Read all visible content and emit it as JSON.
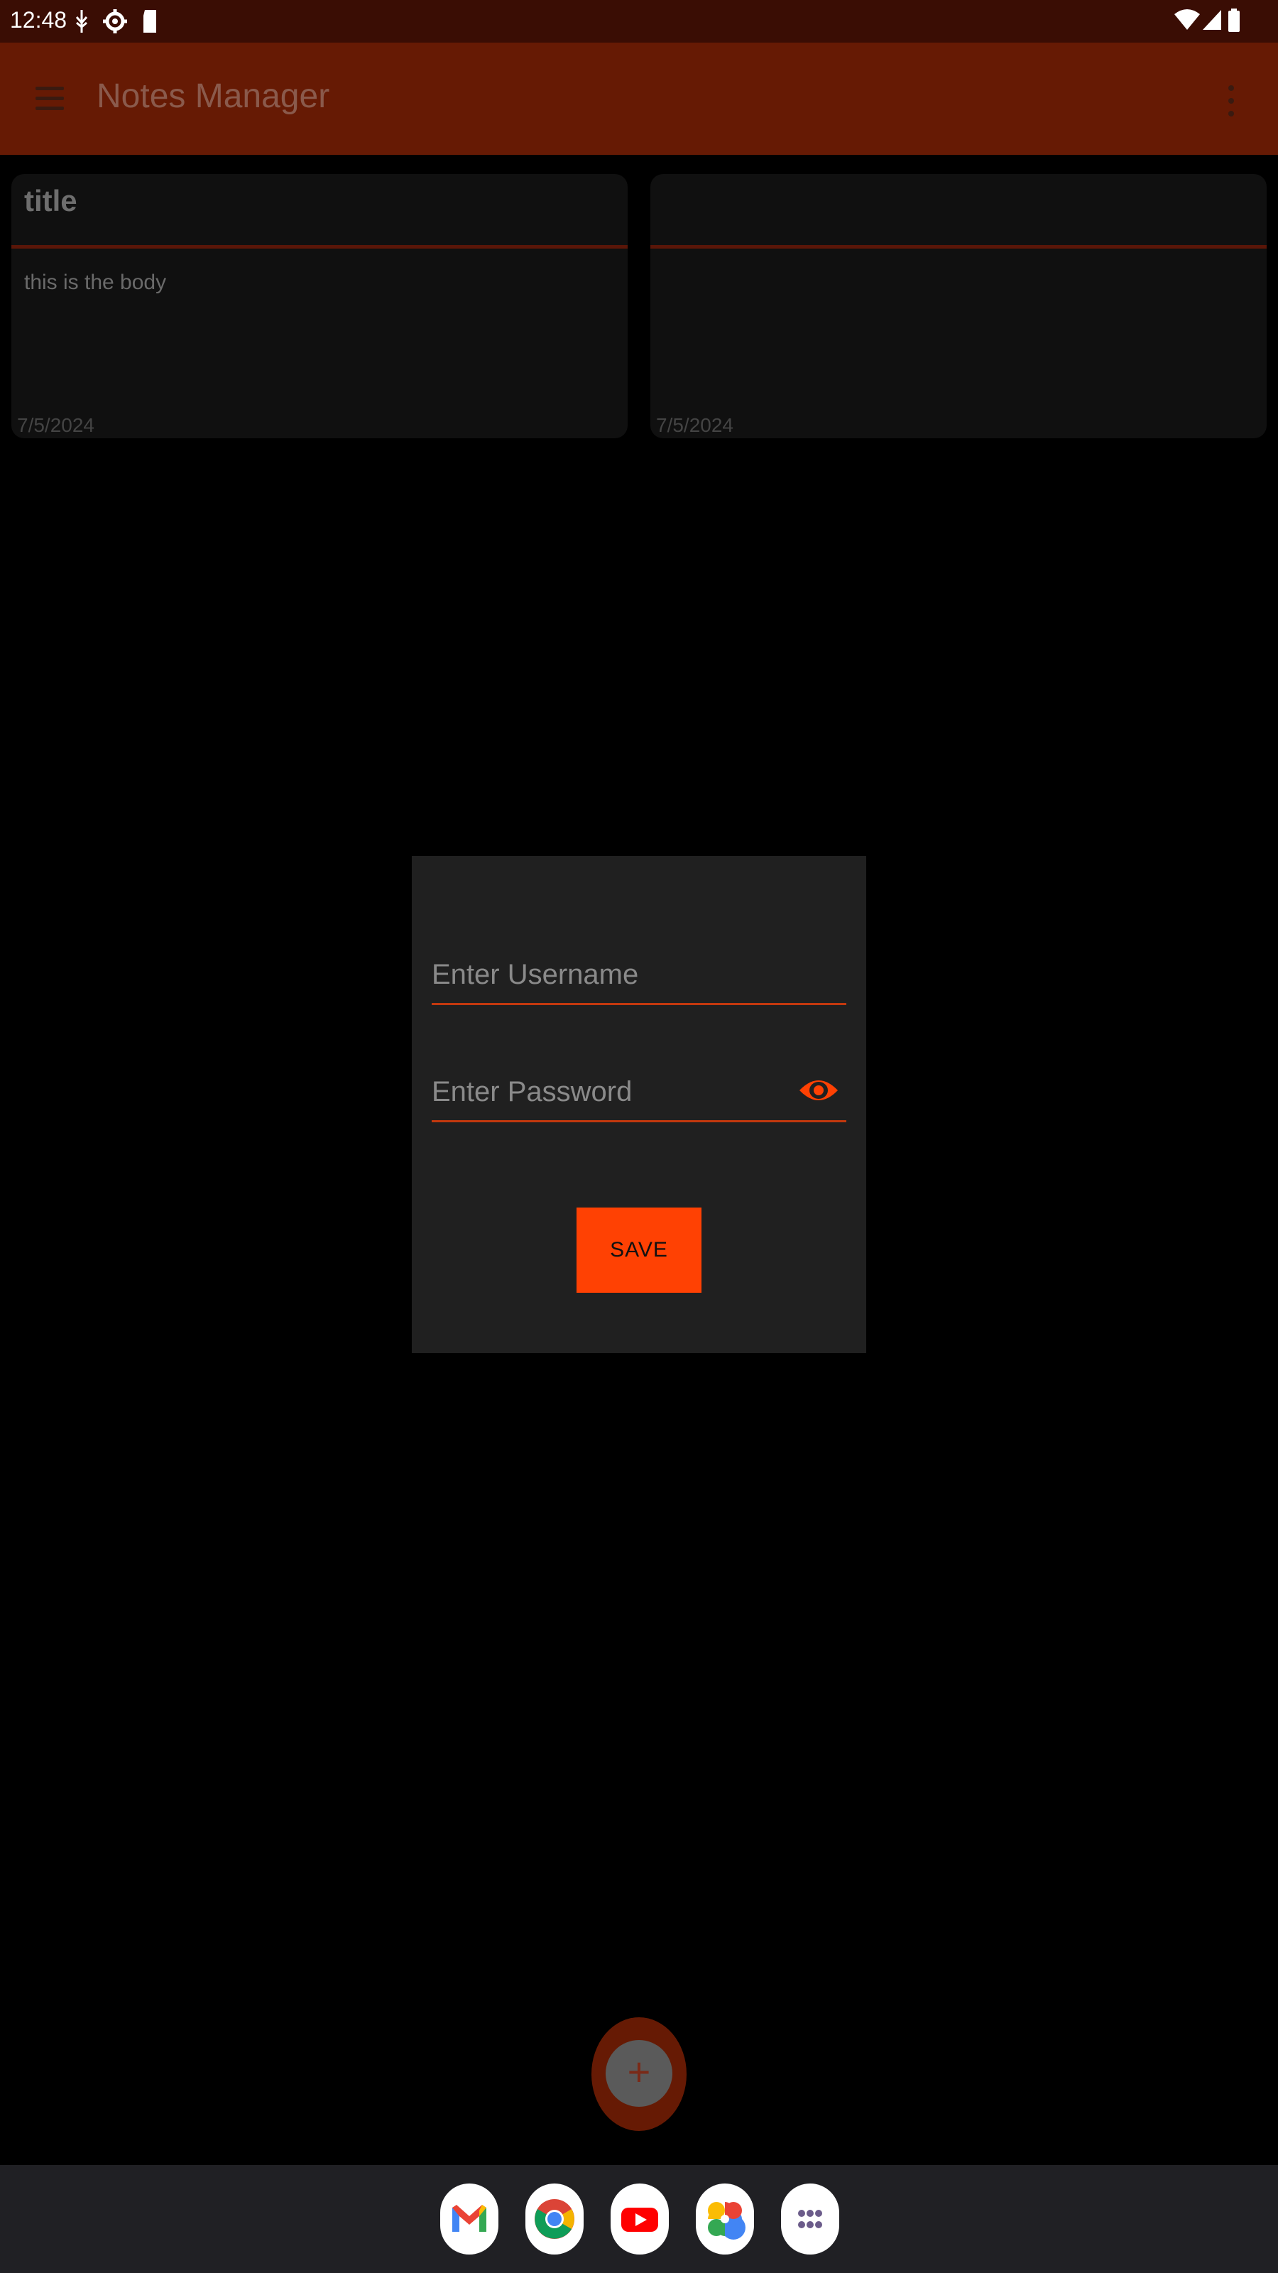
{
  "status_bar": {
    "time": "12:48"
  },
  "app_bar": {
    "title": "Notes Manager"
  },
  "notes": [
    {
      "title": "title",
      "body": "this is the body",
      "date": "7/5/2024"
    },
    {
      "title": "",
      "body": "",
      "date": "7/5/2024"
    }
  ],
  "dialog": {
    "username_placeholder": "Enter Username",
    "password_placeholder": "Enter Password",
    "save_label": "SAVE"
  },
  "fab": {
    "icon": "+"
  },
  "dock": {
    "apps": [
      "gmail",
      "chrome",
      "youtube",
      "photos",
      "app-drawer"
    ]
  },
  "colors": {
    "accent": "#ff4103",
    "appbar": "#661a04",
    "statusbar": "#3a0d04",
    "dialog_bg": "#202020"
  }
}
